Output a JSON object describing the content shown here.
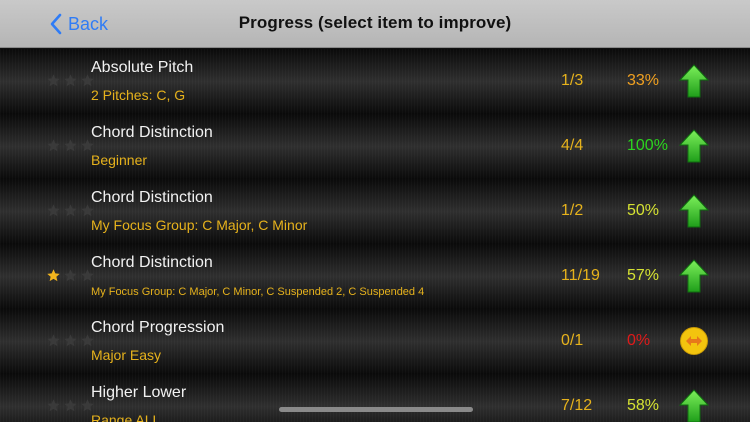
{
  "nav": {
    "back_label": "Back",
    "title": "Progress (select item to improve)"
  },
  "colors": {
    "accent": "#2f7cf6",
    "detail": "#e6b21c",
    "pct_orange": "#f0a020",
    "pct_green": "#2bd51e",
    "pct_yellowgreen": "#d5e232",
    "pct_red": "#e01a1a",
    "star_filled": "#f2b51d",
    "star_empty": "#3a3a3a"
  },
  "rows": [
    {
      "name": "Absolute Pitch",
      "detail": "2 Pitches: C, G",
      "count": "1/3",
      "percent": "33%",
      "stars": 0,
      "icon": "arrow-up-icon",
      "pct_color": "#f0a020"
    },
    {
      "name": "Chord Distinction",
      "detail": "Beginner",
      "count": "4/4",
      "percent": "100%",
      "stars": 0,
      "icon": "arrow-up-icon",
      "pct_color": "#2bd51e"
    },
    {
      "name": "Chord Distinction",
      "detail": "My Focus Group: C Major, C Minor",
      "count": "1/2",
      "percent": "50%",
      "stars": 0,
      "icon": "arrow-up-icon",
      "pct_color": "#d5e232"
    },
    {
      "name": "Chord Distinction",
      "detail": "My Focus Group: C Major, C Minor, C Suspended 2, C Suspended 4",
      "count": "11/19",
      "percent": "57%",
      "stars": 1,
      "icon": "arrow-up-icon",
      "pct_color": "#d5e232",
      "small": true
    },
    {
      "name": "Chord Progression",
      "detail": "Major Easy",
      "count": "0/1",
      "percent": "0%",
      "stars": 0,
      "icon": "swap-horizontal-icon",
      "pct_color": "#e01a1a"
    },
    {
      "name": "Higher Lower",
      "detail": "Range ALL",
      "count": "7/12",
      "percent": "58%",
      "stars": 0,
      "icon": "arrow-up-icon",
      "pct_color": "#d5e232"
    }
  ]
}
